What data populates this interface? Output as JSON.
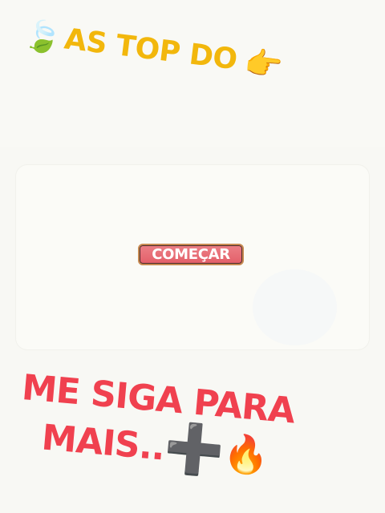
{
  "header": {
    "leaf_icon": "🍃",
    "title": "AS TOP DO",
    "pointer_icon": "👉"
  },
  "card": {
    "start_button_label": "COMEÇAR"
  },
  "cta": {
    "line1": "ME SIGA PARA",
    "line2": "MAIS..",
    "plus_icon": "➕",
    "fire_icon": "🔥"
  },
  "colors": {
    "headline": "#f2b70c",
    "cta": "#f0414f",
    "button": "#e35f69",
    "background": "#f8f8f4"
  }
}
